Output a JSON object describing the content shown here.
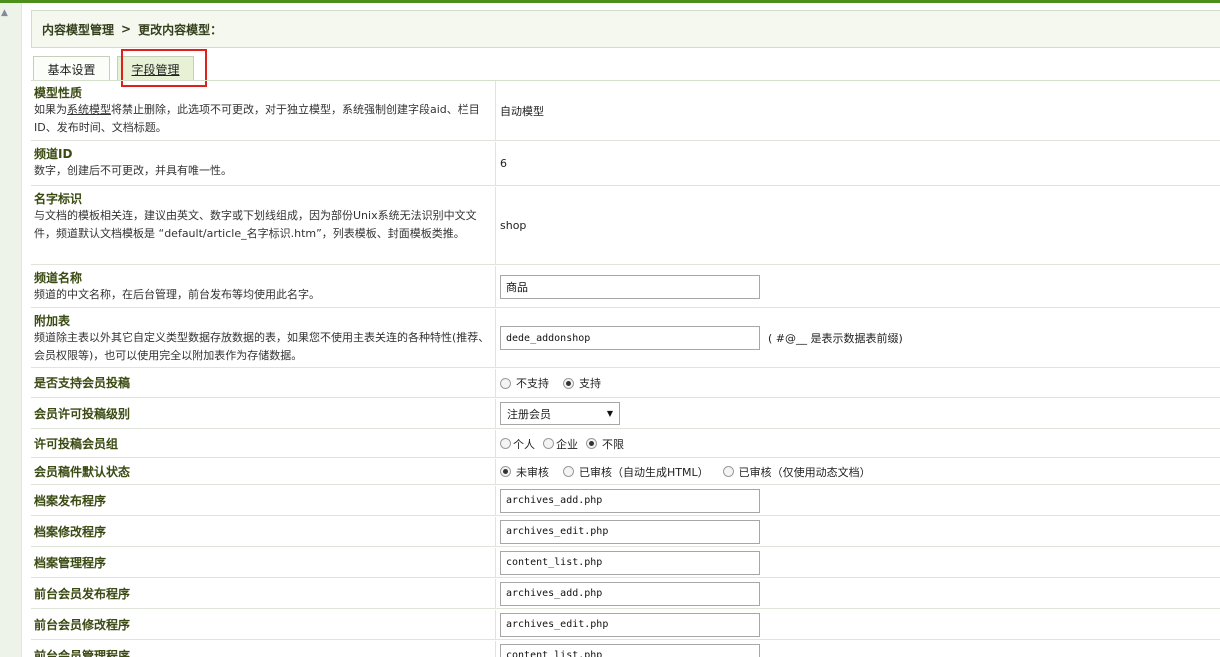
{
  "breadcrumb": {
    "root": "内容模型管理",
    "separator": ">",
    "current": "更改内容模型："
  },
  "tabs": [
    {
      "label": "基本设置"
    },
    {
      "label": "字段管理"
    }
  ],
  "model_type": {
    "label": "模型性质",
    "desc_pre": "如果为",
    "desc_link": "系统模型",
    "desc_post": "将禁止删除，此选项不可更改，对于独立模型，系统强制创建字段aid、栏目ID、发布时间、文档标题。",
    "value": "自动模型"
  },
  "channel_id": {
    "label": "频道ID",
    "desc": "数字，创建后不可更改，并具有唯一性。",
    "value": "6"
  },
  "name_id": {
    "label": "名字标识",
    "desc": "与文档的模板相关连，建议由英文、数字或下划线组成，因为部份Unix系统无法识别中文文件，频道默认文档模板是 “default/article_名字标识.htm”，列表模板、封面模板类推。",
    "value": "shop"
  },
  "channel_name": {
    "label": "频道名称",
    "desc": "频道的中文名称，在后台管理，前台发布等均使用此名字。",
    "value": "商品"
  },
  "addon_table": {
    "label": "附加表",
    "desc": "频道除主表以外其它自定义类型数据存放数据的表，如果您不使用主表关连的各种特性(推荐、会员权限等)，也可以使用完全以附加表作为存储数据。",
    "value": "dede_addonshop",
    "hint": "( #@__ 是表示数据表前缀)"
  },
  "member_submit": {
    "label": "是否支持会员投稿",
    "options": [
      "不支持",
      "支持"
    ],
    "selected": "支持"
  },
  "member_level": {
    "label": "会员许可投稿级别",
    "selected": "注册会员"
  },
  "member_group": {
    "label": "许可投稿会员组",
    "options": [
      "个人",
      "企业",
      "不限"
    ],
    "selected": "不限"
  },
  "member_status": {
    "label": "会员稿件默认状态",
    "options": [
      "未审核",
      "已审核（自动生成HTML）",
      "已审核（仅使用动态文档）"
    ],
    "selected": "未审核"
  },
  "programs": [
    {
      "label": "档案发布程序",
      "value": "archives_add.php"
    },
    {
      "label": "档案修改程序",
      "value": "archives_edit.php"
    },
    {
      "label": "档案管理程序",
      "value": "content_list.php"
    },
    {
      "label": "前台会员发布程序",
      "value": "archives_add.php"
    },
    {
      "label": "前台会员修改程序",
      "value": "archives_edit.php"
    },
    {
      "label": "前台会员管理程序",
      "value": "content_list.php"
    }
  ],
  "colors": {
    "accent": "#4c8f1a",
    "highlight": "#e0201c",
    "label": "#3a4a12"
  }
}
